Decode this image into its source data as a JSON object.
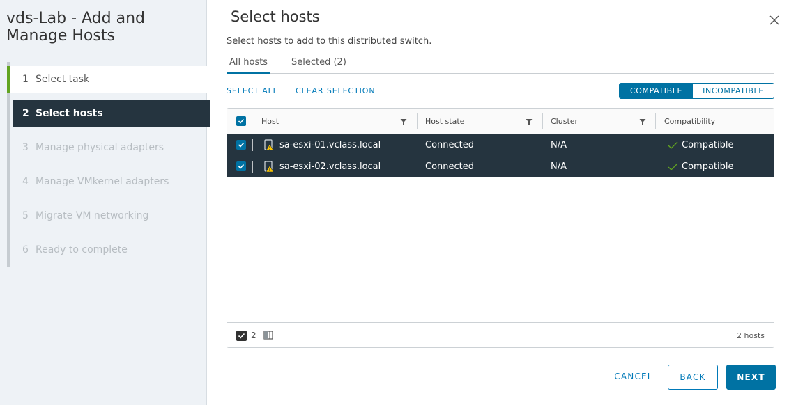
{
  "wizard": {
    "title_line1": "vds-Lab - Add and",
    "title_line2": "Manage Hosts",
    "steps": [
      {
        "num": "1",
        "label": "Select task",
        "state": "done"
      },
      {
        "num": "2",
        "label": "Select hosts",
        "state": "active"
      },
      {
        "num": "3",
        "label": "Manage physical adapters",
        "state": "pending"
      },
      {
        "num": "4",
        "label": "Manage VMkernel adapters",
        "state": "pending"
      },
      {
        "num": "5",
        "label": "Migrate VM networking",
        "state": "pending"
      },
      {
        "num": "6",
        "label": "Ready to complete",
        "state": "pending"
      }
    ]
  },
  "page": {
    "title": "Select hosts",
    "subtitle": "Select hosts to add to this distributed switch."
  },
  "tabs": [
    {
      "label": "All hosts",
      "active": true
    },
    {
      "label": "Selected (2)",
      "active": false
    }
  ],
  "actions": {
    "select_all": "SELECT ALL",
    "clear_selection": "CLEAR SELECTION"
  },
  "filter_toggle": {
    "compatible": "COMPATIBLE",
    "incompatible": "INCOMPATIBLE",
    "selected": "compatible"
  },
  "grid": {
    "columns": [
      "Host",
      "Host state",
      "Cluster",
      "Compatibility"
    ],
    "rows": [
      {
        "host": "sa-esxi-01.vclass.local",
        "state": "Connected",
        "cluster": "N/A",
        "compat": "Compatible",
        "selected": true,
        "icon": "host-warning-icon"
      },
      {
        "host": "sa-esxi-02.vclass.local",
        "state": "Connected",
        "cluster": "N/A",
        "compat": "Compatible",
        "selected": true,
        "icon": "host-warning-icon"
      }
    ],
    "footer": {
      "selected_count": "2",
      "total": "2 hosts"
    }
  },
  "buttons": {
    "cancel": "CANCEL",
    "back": "BACK",
    "next": "NEXT"
  },
  "colors": {
    "accent": "#0072a3",
    "selected_row": "#25343f",
    "done_step": "#62a420",
    "compatible_check": "#62a420",
    "warning": "#fac400"
  }
}
